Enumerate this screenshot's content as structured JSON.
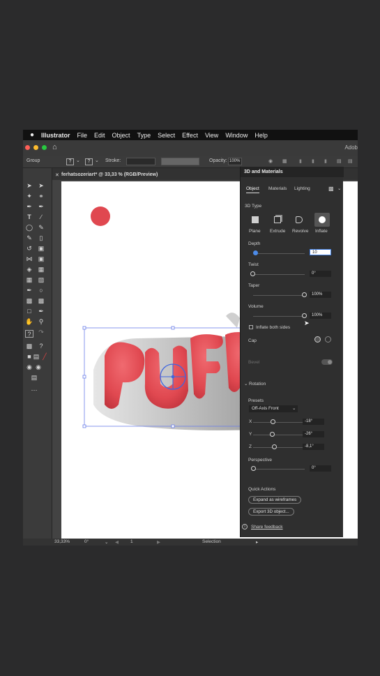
{
  "menubar": {
    "app_name": "Illustrator",
    "items": [
      "File",
      "Edit",
      "Object",
      "Type",
      "Select",
      "Effect",
      "View",
      "Window",
      "Help"
    ]
  },
  "titlebar": {
    "right_text": "Adob"
  },
  "control_bar": {
    "selection_label": "Group",
    "fill_symbol": "?",
    "stroke_symbol": "?",
    "stroke_label": "Stroke:",
    "opacity_label": "Opacity:",
    "opacity_value": "100%"
  },
  "document": {
    "tab_title": "ferhatsozeriart* @ 33,33 % (RGB/Preview)",
    "artwork_text": "PUFF"
  },
  "panel": {
    "title": "3D and Materials",
    "tabs": [
      "Object",
      "Materials",
      "Lighting"
    ],
    "active_tab": "Object",
    "type_section_label": "3D Type",
    "types": [
      "Plane",
      "Extrude",
      "Revolve",
      "Inflate"
    ],
    "selected_type": "Inflate",
    "depth": {
      "label": "Depth",
      "value": "10",
      "level": 0.02
    },
    "twist": {
      "label": "Twist",
      "value": "0°",
      "level": 0.0
    },
    "taper": {
      "label": "Taper",
      "value": "100%",
      "level": 1.0
    },
    "volume": {
      "label": "Volume",
      "value": "100%",
      "level": 1.0
    },
    "inflate_both_label": "Inflate both sides",
    "cap_label": "Cap",
    "bevel_label": "Bevel",
    "rotation_label": "Rotation",
    "presets_label": "Presets",
    "preset_value": "Off-Axis Front",
    "axes": [
      {
        "label": "X",
        "value": "-18°",
        "level": 0.45
      },
      {
        "label": "Y",
        "value": "-26°",
        "level": 0.43
      },
      {
        "label": "Z",
        "value": "-8,1°",
        "level": 0.48
      }
    ],
    "perspective": {
      "label": "Perspective",
      "value": "0°",
      "level": 0.0
    },
    "quick_actions_label": "Quick Actions",
    "expand_button": "Expand as wireframes",
    "export_button": "Export 3D object...",
    "feedback_link": "Share feedback"
  },
  "statusbar": {
    "zoom": "33,33%",
    "rotation": "0°",
    "artboard": "1",
    "tool": "Selection"
  },
  "colors": {
    "accent": "#4c8be8",
    "artwork_red": "#e04850",
    "panel_bg": "#2f2f2f"
  }
}
